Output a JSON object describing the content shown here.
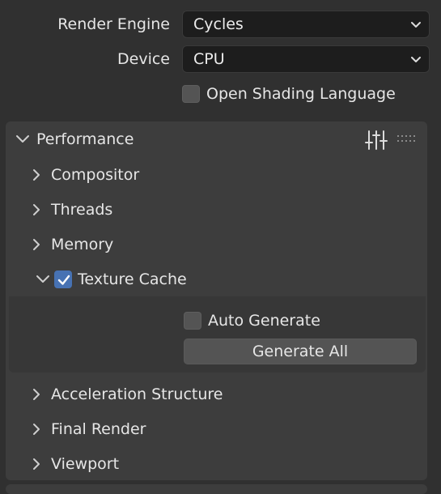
{
  "render": {
    "engine_label": "Render Engine",
    "engine_value": "Cycles",
    "device_label": "Device",
    "device_value": "CPU",
    "osl_label": "Open Shading Language",
    "osl_checked": false
  },
  "performance": {
    "title": "Performance",
    "icons": [
      "chevron-down-icon",
      "sliders-icon",
      "drag-grip-icon"
    ],
    "subpanels": [
      {
        "label": "Compositor",
        "expanded": false
      },
      {
        "label": "Threads",
        "expanded": false
      },
      {
        "label": "Memory",
        "expanded": false
      },
      {
        "label": "Texture Cache",
        "expanded": true,
        "checked": true
      },
      {
        "label": "Acceleration Structure",
        "expanded": false
      },
      {
        "label": "Final Render",
        "expanded": false
      },
      {
        "label": "Viewport",
        "expanded": false
      }
    ],
    "texture_cache": {
      "auto_generate_label": "Auto Generate",
      "auto_generate_checked": false,
      "generate_all_label": "Generate All"
    }
  },
  "colors": {
    "background": "#303030",
    "panel": "#3d3d3d",
    "field": "#1d1d1d",
    "accent": "#4772b3",
    "text": "#e6e6e6"
  }
}
